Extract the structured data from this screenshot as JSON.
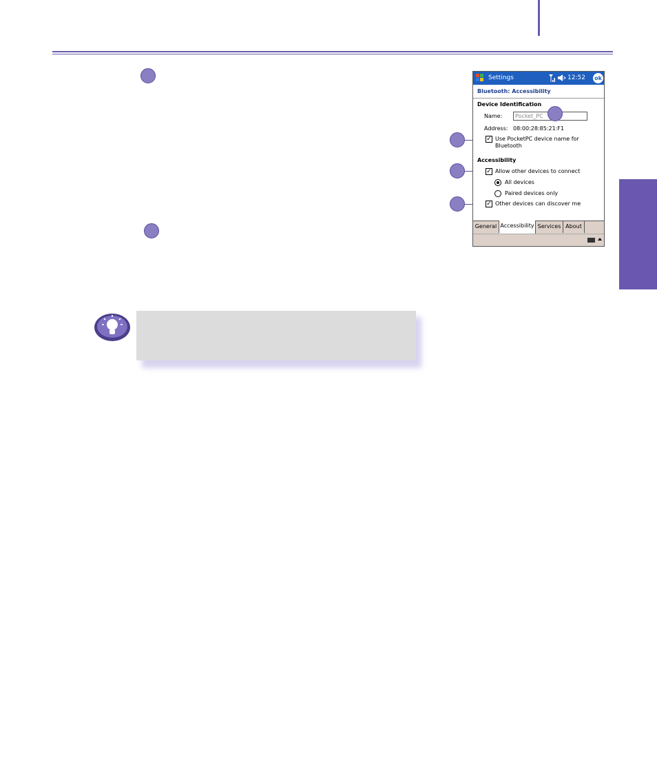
{
  "pda": {
    "titlebar": {
      "app_name": "Settings",
      "time": "12:52",
      "ok_label": "ok"
    },
    "heading": "Bluetooth: Accessibility",
    "device_identification": {
      "section_label": "Device Identification",
      "name_label": "Name:",
      "name_value": "Pocket_PC",
      "address_label": "Address:",
      "address_value": "08:00:28:85:21:F1",
      "use_name_label_line1": "Use PocketPC device name for",
      "use_name_label_line2": "Bluetooth",
      "use_name_checked": true
    },
    "accessibility": {
      "section_label": "Accessibility",
      "allow_connect_label": "Allow other devices to connect",
      "allow_connect_checked": true,
      "options": [
        "All devices",
        "Paired devices only"
      ],
      "selected_option": "All devices",
      "discover_label": "Other devices can discover me",
      "discover_checked": true
    },
    "tabs": [
      "General",
      "Accessibility",
      "Services",
      "About"
    ],
    "active_tab": "Accessibility"
  },
  "icons": {
    "tip": "lightbulb-icon",
    "start": "windows-start-icon",
    "signal": "signal-icon",
    "volume": "speaker-icon",
    "keyboard": "keyboard-icon"
  },
  "colors": {
    "accent": "#6a57b0",
    "callout": "#8b7fc4",
    "titlebar": "#1e5fbf",
    "tip_box": "#dcdcdc"
  }
}
